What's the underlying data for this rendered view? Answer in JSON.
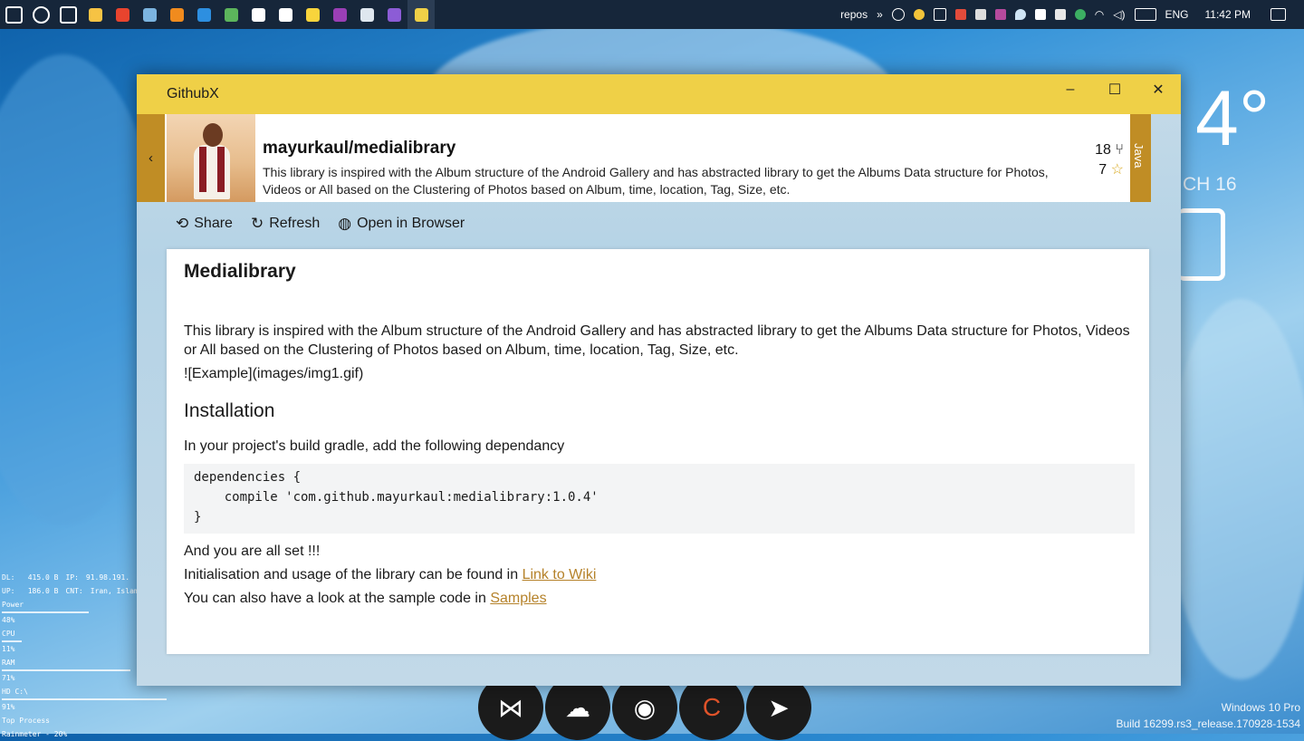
{
  "taskbar": {
    "icons": [
      {
        "name": "start-icon",
        "color": "#ffffff"
      },
      {
        "name": "cortana-icon",
        "color": "#ffffff"
      },
      {
        "name": "task-view-icon",
        "color": "#ffffff"
      },
      {
        "name": "file-explorer-icon",
        "color": "#f6c344"
      },
      {
        "name": "opera-icon",
        "color": "#e8442e"
      },
      {
        "name": "remote-desktop-icon",
        "color": "#7cb4e0"
      },
      {
        "name": "sublime-icon",
        "color": "#f08b1e"
      },
      {
        "name": "vscode-icon",
        "color": "#2d8fe0"
      },
      {
        "name": "git-kraken-icon",
        "color": "#5cb55c"
      },
      {
        "name": "telegram-icon",
        "color": "#ffffff"
      },
      {
        "name": "notion-icon",
        "color": "#ffffff"
      },
      {
        "name": "sticky-notes-icon",
        "color": "#f8d43c"
      },
      {
        "name": "onenote-icon",
        "color": "#9a3fb5"
      },
      {
        "name": "photos-icon",
        "color": "#dfe7ef"
      },
      {
        "name": "visual-studio-icon",
        "color": "#8c5cd6"
      },
      {
        "name": "githubx-icon",
        "color": "#efd047"
      }
    ],
    "repos_label": "repos",
    "chevron": "»",
    "lang": "ENG",
    "time": "11:42 PM"
  },
  "desktop": {
    "temperature": "4°",
    "date": "CH 16",
    "watermark_line1": "Windows 10 Pro",
    "watermark_line2": "Build 16299.rs3_release.170928-1534",
    "rainmeter": {
      "dl_label": "DL:",
      "dl_value": "415.0 B",
      "ip_label": "IP:",
      "ip_value": "91.98.191.",
      "up_label": "UP:",
      "up_value": "186.0 B",
      "cnt_label": "CNT:",
      "cnt_value": "Iran, Islam",
      "power_label": "Power",
      "power_value": "48%",
      "power_fraction": 0.48,
      "cpu_label": "CPU",
      "cpu_value": "11%",
      "cpu_fraction": 0.11,
      "ram_label": "RAM",
      "ram_value": "71%",
      "ram_fraction": 0.71,
      "hd_label": "HD C:\\",
      "hd_value": "91%",
      "hd_fraction": 0.91,
      "top_label": "Top Process",
      "top_value": "Rainmeter - 20%"
    },
    "dock": [
      "visual-studio",
      "onedrive",
      "github",
      "ccleaner",
      "telegram"
    ]
  },
  "window": {
    "app_title": "GithubX",
    "minimize": "–",
    "maximize": "☐",
    "close": "✕",
    "back": "‹",
    "repo_name": "mayurkaul/medialibrary",
    "repo_description": "This library is inspired with the Album structure of the Android Gallery and has abstracted library to get the Albums Data structure for Photos, Videos or All based on the Clustering of Photos based on Album, time, location, Tag, Size, etc.",
    "forks": "18",
    "stars": "7",
    "language": "Java",
    "toolbar": {
      "share": "Share",
      "refresh": "Refresh",
      "open_browser": "Open in Browser"
    },
    "readme": {
      "title": "Medialibrary",
      "intro": "This library is inspired with the Album structure of the Android Gallery and has abstracted library to get the Albums Data structure for Photos, Videos or All based on the Clustering of Photos based on Album, time, location, Tag, Size, etc.",
      "image_md": "![Example](images/img1.gif)",
      "installation": "Installation",
      "install_text": "In your project's build gradle, add the following dependancy",
      "code": "dependencies {\n    compile 'com.github.mayurkaul:medialibrary:1.0.4'\n}",
      "all_set": "And you are all set !!!",
      "wiki_prefix": "Initialisation and usage of the library can be found in ",
      "wiki_link": "Link to Wiki",
      "samples_prefix": "You can also have a look at the sample code in ",
      "samples_link": "Samples"
    }
  }
}
